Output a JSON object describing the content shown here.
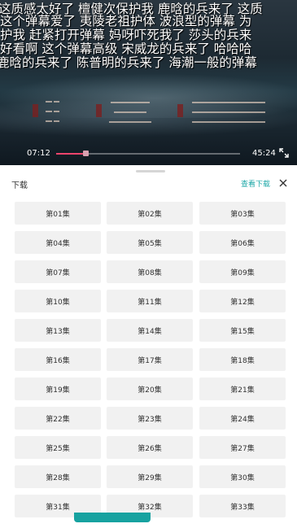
{
  "danmaku": [
    "这质感太好了  檀健次保护我  鹿晗的兵来了  这质",
    " 这个弹幕爱了  夷陵老祖护体  波浪型的弹幕  为",
    "护我  赶紧打开弹幕  妈呀吓死我了  莎头的兵来",
    "好看啊  这个弹幕高级  宋威龙的兵来了  哈哈哈",
    "鹿晗的兵来了  陈普明的兵来了  海潮一般的弹幕"
  ],
  "player": {
    "current_time": "07:12",
    "total_time": "45:24",
    "progress_fraction": 0.158
  },
  "sheet": {
    "title": "下载",
    "view_downloads_label": "查看下载",
    "episodes": [
      "第01集",
      "第02集",
      "第03集",
      "第04集",
      "第05集",
      "第06集",
      "第07集",
      "第08集",
      "第09集",
      "第10集",
      "第11集",
      "第12集",
      "第13集",
      "第14集",
      "第15集",
      "第16集",
      "第17集",
      "第18集",
      "第19集",
      "第20集",
      "第21集",
      "第22集",
      "第23集",
      "第24集",
      "第25集",
      "第26集",
      "第27集",
      "第28集",
      "第29集",
      "第30集",
      "第31集",
      "第32集",
      "第33集"
    ]
  },
  "colors": {
    "accent": "#1aa6a6",
    "progress": "#f0446c",
    "episode_bg": "#f1f1f1"
  },
  "icons": {
    "close": "close-icon",
    "fullscreen": "fullscreen-icon"
  }
}
